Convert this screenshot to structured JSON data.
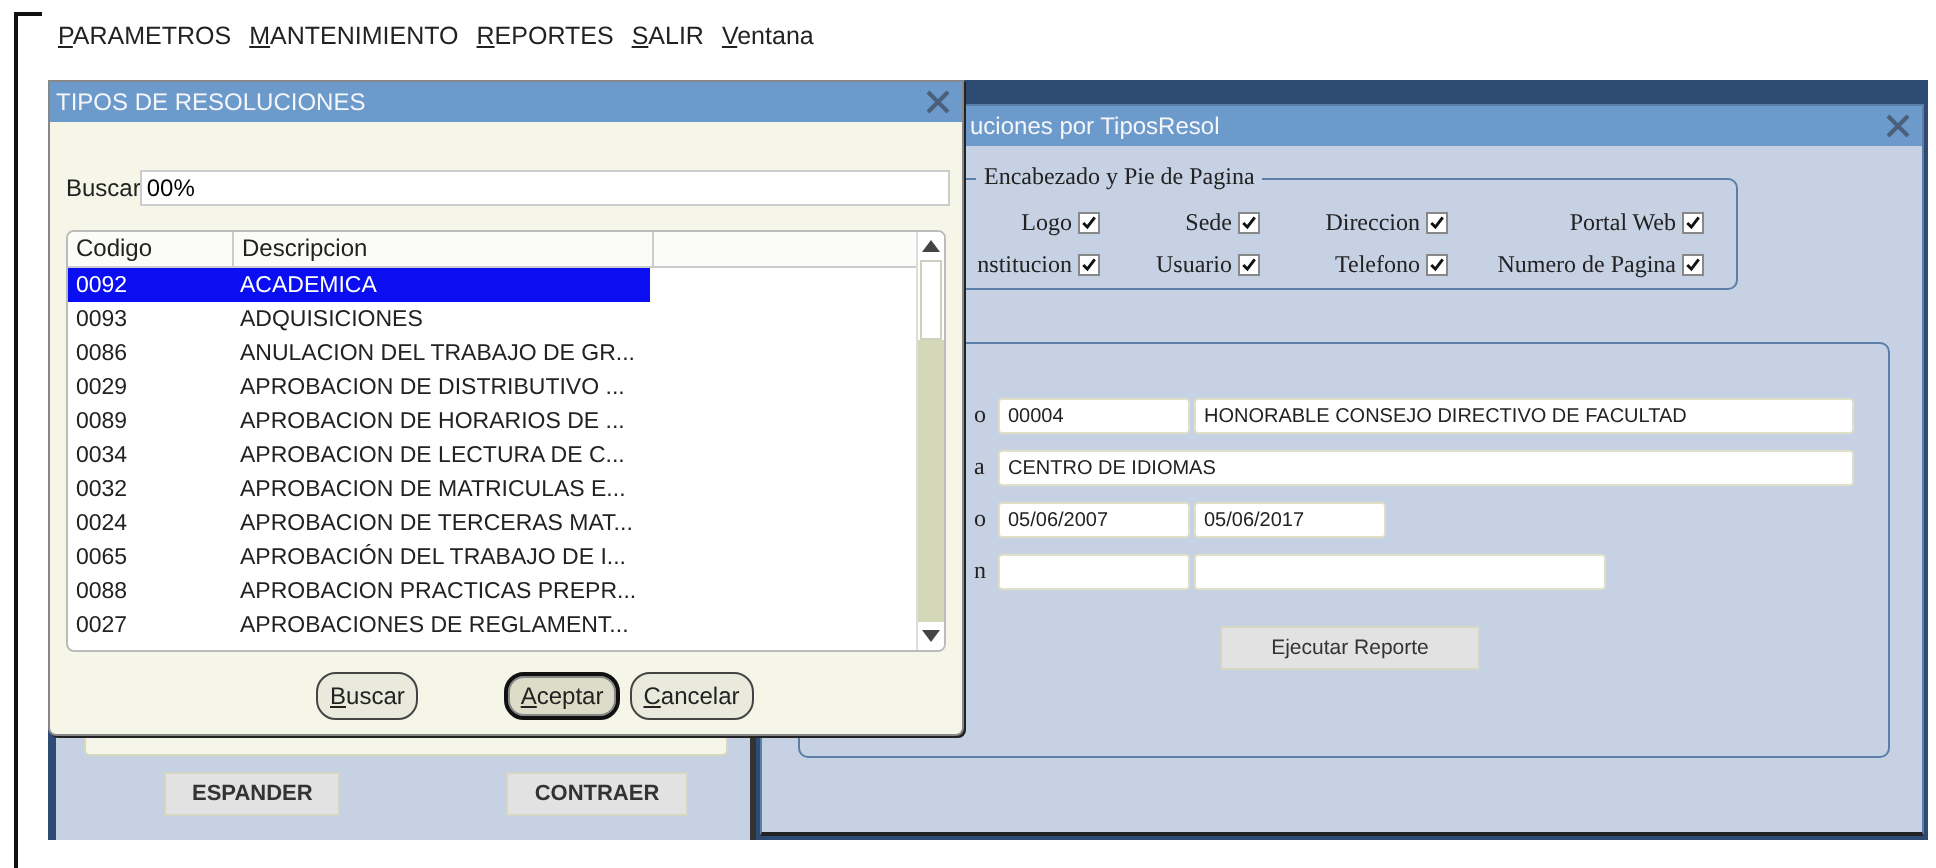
{
  "menu": [
    "PARAMETROS",
    "MANTENIMIENTO",
    "REPORTES",
    "SALIR",
    "Ventana"
  ],
  "back_window": {
    "buttons": [
      "ESPANDER",
      "CONTRAER"
    ]
  },
  "report_window": {
    "title": "uciones por TiposResol",
    "group": {
      "title": "Encabezado y Pie de Pagina",
      "checkboxes": [
        {
          "label": "Logo",
          "checked": true
        },
        {
          "label": "Sede",
          "checked": true
        },
        {
          "label": "Direccion",
          "checked": true
        },
        {
          "label": "Portal Web",
          "checked": true
        },
        {
          "label": "nstitucion",
          "checked": true
        },
        {
          "label": "Usuario",
          "checked": true
        },
        {
          "label": "Telefono",
          "checked": true
        },
        {
          "label": "Numero de Pagina",
          "checked": true
        }
      ]
    },
    "form_rows": [
      {
        "label": "o",
        "fields": [
          {
            "kind": "text",
            "value": "00004"
          },
          {
            "kind": "text",
            "value": "HONORABLE CONSEJO DIRECTIVO DE FACULTAD"
          }
        ]
      },
      {
        "label": "a",
        "fields": [
          {
            "kind": "text",
            "value": "CENTRO DE IDIOMAS"
          }
        ]
      },
      {
        "label": "o",
        "fields": [
          {
            "kind": "text",
            "value": "05/06/2007"
          },
          {
            "kind": "text",
            "value": "05/06/2017"
          }
        ]
      },
      {
        "label": "n",
        "fields": [
          {
            "kind": "blank"
          },
          {
            "kind": "blank"
          }
        ]
      }
    ],
    "button": "Ejecutar Reporte"
  },
  "dialog": {
    "title": "TIPOS DE RESOLUCIONES",
    "search": {
      "label": "Buscar",
      "value": "00%"
    },
    "table": {
      "columns": [
        "Codigo",
        "Descripcion"
      ],
      "rows": [
        {
          "code": "0092",
          "description": "ACADEMICA",
          "selected": true
        },
        {
          "code": "0093",
          "description": "ADQUISICIONES",
          "selected": false
        },
        {
          "code": "0086",
          "description": "ANULACION DEL TRABAJO DE GR...",
          "selected": false
        },
        {
          "code": "0029",
          "description": "APROBACION DE DISTRIBUTIVO ...",
          "selected": false
        },
        {
          "code": "0089",
          "description": "APROBACION DE HORARIOS DE ...",
          "selected": false
        },
        {
          "code": "0034",
          "description": "APROBACION DE LECTURA DE C...",
          "selected": false
        },
        {
          "code": "0032",
          "description": "APROBACION DE MATRICULAS E...",
          "selected": false
        },
        {
          "code": "0024",
          "description": "APROBACION DE TERCERAS MAT...",
          "selected": false
        },
        {
          "code": "0065",
          "description": "APROBACIÓN DEL TRABAJO DE I...",
          "selected": false
        },
        {
          "code": "0088",
          "description": "APROBACION PRACTICAS PREPR...",
          "selected": false
        },
        {
          "code": "0027",
          "description": "APROBACIONES DE REGLAMENT...",
          "selected": false
        }
      ]
    },
    "buttons": [
      {
        "label": "Buscar",
        "selected": false
      },
      {
        "label": "Aceptar",
        "selected": true
      },
      {
        "label": "Cancelar",
        "selected": false
      }
    ]
  }
}
